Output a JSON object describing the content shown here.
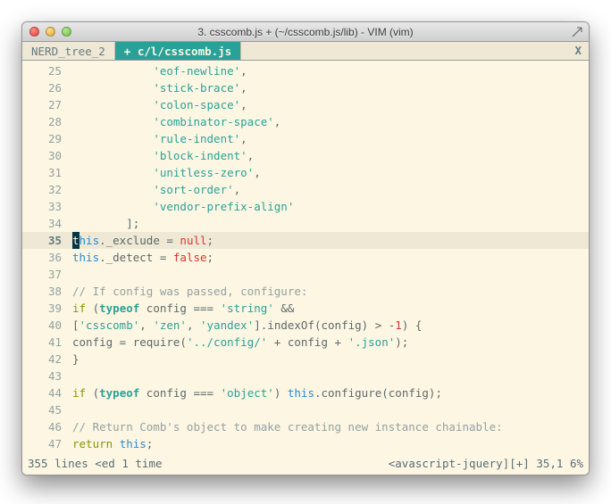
{
  "window": {
    "title": "3. csscomb.js + (~/csscomb.js/lib) - VIM (vim)"
  },
  "tabs": {
    "inactive": "NERD_tree_2",
    "active": "+ c/l/csscomb.js",
    "close": "X"
  },
  "lines": [
    {
      "n": "25",
      "seg": [
        [
          "            ",
          ""
        ],
        [
          "'eof-newline'",
          "str"
        ],
        [
          ",",
          ""
        ]
      ]
    },
    {
      "n": "26",
      "seg": [
        [
          "            ",
          ""
        ],
        [
          "'stick-brace'",
          "str"
        ],
        [
          ",",
          ""
        ]
      ]
    },
    {
      "n": "27",
      "seg": [
        [
          "            ",
          ""
        ],
        [
          "'colon-space'",
          "str"
        ],
        [
          ",",
          ""
        ]
      ]
    },
    {
      "n": "28",
      "seg": [
        [
          "            ",
          ""
        ],
        [
          "'combinator-space'",
          "str"
        ],
        [
          ",",
          ""
        ]
      ]
    },
    {
      "n": "29",
      "seg": [
        [
          "            ",
          ""
        ],
        [
          "'rule-indent'",
          "str"
        ],
        [
          ",",
          ""
        ]
      ]
    },
    {
      "n": "30",
      "seg": [
        [
          "            ",
          ""
        ],
        [
          "'block-indent'",
          "str"
        ],
        [
          ",",
          ""
        ]
      ]
    },
    {
      "n": "31",
      "seg": [
        [
          "            ",
          ""
        ],
        [
          "'unitless-zero'",
          "str"
        ],
        [
          ",",
          ""
        ]
      ]
    },
    {
      "n": "32",
      "seg": [
        [
          "            ",
          ""
        ],
        [
          "'sort-order'",
          "str"
        ],
        [
          ",",
          ""
        ]
      ]
    },
    {
      "n": "33",
      "seg": [
        [
          "            ",
          ""
        ],
        [
          "'vendor-prefix-align'",
          "str"
        ]
      ]
    },
    {
      "n": "34",
      "seg": [
        [
          "        ];",
          ""
        ]
      ]
    },
    {
      "n": "35",
      "cur": true,
      "seg": [
        [
          "t",
          "cursor"
        ],
        [
          "his",
          "var"
        ],
        [
          "._exclude = ",
          ""
        ],
        [
          "null",
          "lit"
        ],
        [
          ";",
          ""
        ]
      ]
    },
    {
      "n": "36",
      "seg": [
        [
          "this",
          "var"
        ],
        [
          "._detect = ",
          ""
        ],
        [
          "false",
          "lit"
        ],
        [
          ";",
          ""
        ]
      ]
    },
    {
      "n": "37",
      "seg": []
    },
    {
      "n": "38",
      "seg": [
        [
          "// If config was passed, configure:",
          "com"
        ]
      ]
    },
    {
      "n": "39",
      "seg": [
        [
          "if",
          "kw2"
        ],
        [
          " (",
          ""
        ],
        [
          "typeof",
          "kw"
        ],
        [
          " config === ",
          ""
        ],
        [
          "'string'",
          "str"
        ],
        [
          " &&",
          ""
        ]
      ]
    },
    {
      "n": "40",
      "seg": [
        [
          "[",
          ""
        ],
        [
          "'csscomb'",
          "str"
        ],
        [
          ", ",
          ""
        ],
        [
          "'zen'",
          "str"
        ],
        [
          ", ",
          ""
        ],
        [
          "'yandex'",
          "str"
        ],
        [
          "].indexOf(config) > -",
          ""
        ],
        [
          "1",
          "lit"
        ],
        [
          ") {",
          ""
        ]
      ]
    },
    {
      "n": "41",
      "seg": [
        [
          "config = require(",
          ""
        ],
        [
          "'../config/'",
          "str"
        ],
        [
          " + config + ",
          ""
        ],
        [
          "'.json'",
          "str"
        ],
        [
          ");",
          ""
        ]
      ]
    },
    {
      "n": "42",
      "seg": [
        [
          "}",
          ""
        ]
      ]
    },
    {
      "n": "43",
      "seg": []
    },
    {
      "n": "44",
      "seg": [
        [
          "if",
          "kw2"
        ],
        [
          " (",
          ""
        ],
        [
          "typeof",
          "kw"
        ],
        [
          " config === ",
          ""
        ],
        [
          "'object'",
          "str"
        ],
        [
          ") ",
          ""
        ],
        [
          "this",
          "var"
        ],
        [
          ".configure(config);",
          ""
        ]
      ]
    },
    {
      "n": "45",
      "seg": []
    },
    {
      "n": "46",
      "seg": [
        [
          "// Return Comb's object to make creating new instance chainable:",
          "com"
        ]
      ]
    },
    {
      "n": "47",
      "seg": [
        [
          "return",
          "kw2"
        ],
        [
          " ",
          ""
        ],
        [
          "this",
          "var"
        ],
        [
          ";",
          ""
        ]
      ]
    }
  ],
  "status": {
    "left": "355 lines <ed 1 time",
    "right": "<avascript-jquery][+] 35,1   6%"
  }
}
